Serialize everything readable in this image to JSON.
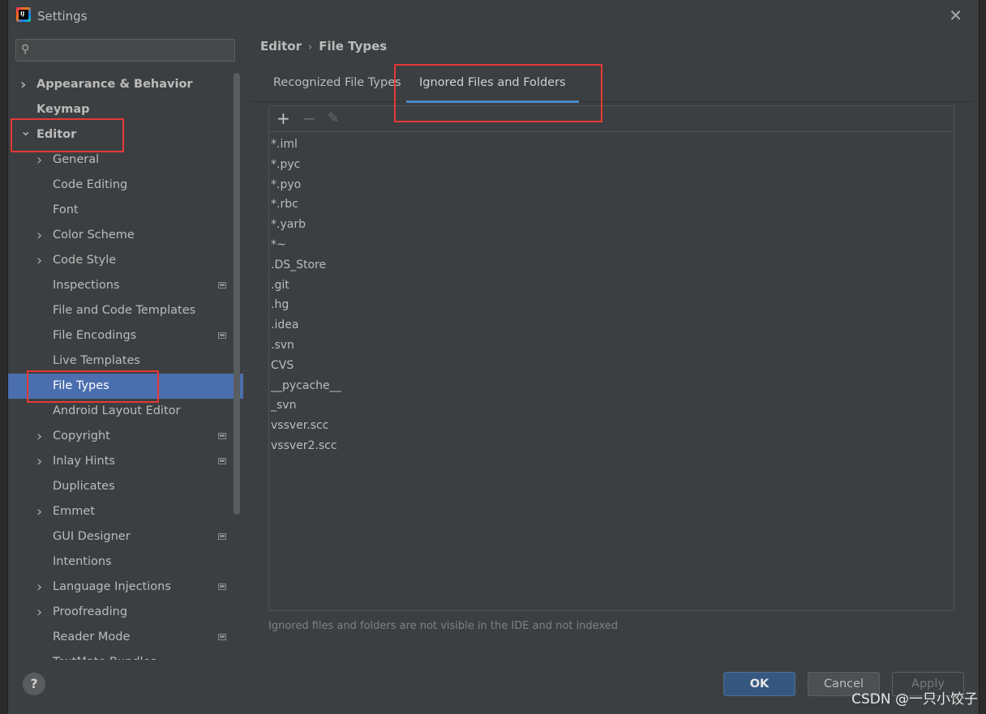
{
  "window": {
    "title": "Settings",
    "close_symbol": "✕"
  },
  "search": {
    "placeholder": "",
    "icon": "search-icon"
  },
  "sidebar": {
    "items": [
      {
        "label": "Appearance & Behavior",
        "level": 0,
        "expandable": true,
        "expanded": false,
        "bold": true,
        "options_icon": false
      },
      {
        "label": "Keymap",
        "level": 0,
        "expandable": false,
        "bold": true,
        "options_icon": false
      },
      {
        "label": "Editor",
        "level": 0,
        "expandable": true,
        "expanded": true,
        "bold": true,
        "options_icon": false
      },
      {
        "label": "General",
        "level": 1,
        "expandable": true,
        "expanded": false,
        "options_icon": false
      },
      {
        "label": "Code Editing",
        "level": 1,
        "expandable": false,
        "options_icon": false
      },
      {
        "label": "Font",
        "level": 1,
        "expandable": false,
        "options_icon": false
      },
      {
        "label": "Color Scheme",
        "level": 1,
        "expandable": true,
        "expanded": false,
        "options_icon": false
      },
      {
        "label": "Code Style",
        "level": 1,
        "expandable": true,
        "expanded": false,
        "options_icon": false
      },
      {
        "label": "Inspections",
        "level": 1,
        "expandable": false,
        "options_icon": true
      },
      {
        "label": "File and Code Templates",
        "level": 1,
        "expandable": false,
        "options_icon": false
      },
      {
        "label": "File Encodings",
        "level": 1,
        "expandable": false,
        "options_icon": true
      },
      {
        "label": "Live Templates",
        "level": 1,
        "expandable": false,
        "options_icon": false
      },
      {
        "label": "File Types",
        "level": 1,
        "expandable": false,
        "selected": true,
        "options_icon": false
      },
      {
        "label": "Android Layout Editor",
        "level": 1,
        "expandable": false,
        "options_icon": false
      },
      {
        "label": "Copyright",
        "level": 1,
        "expandable": true,
        "expanded": false,
        "options_icon": true
      },
      {
        "label": "Inlay Hints",
        "level": 1,
        "expandable": true,
        "expanded": false,
        "options_icon": true
      },
      {
        "label": "Duplicates",
        "level": 1,
        "expandable": false,
        "options_icon": false
      },
      {
        "label": "Emmet",
        "level": 1,
        "expandable": true,
        "expanded": false,
        "options_icon": false
      },
      {
        "label": "GUI Designer",
        "level": 1,
        "expandable": false,
        "options_icon": true
      },
      {
        "label": "Intentions",
        "level": 1,
        "expandable": false,
        "options_icon": false
      },
      {
        "label": "Language Injections",
        "level": 1,
        "expandable": true,
        "expanded": false,
        "options_icon": true
      },
      {
        "label": "Proofreading",
        "level": 1,
        "expandable": true,
        "expanded": false,
        "options_icon": false
      },
      {
        "label": "Reader Mode",
        "level": 1,
        "expandable": false,
        "options_icon": true
      },
      {
        "label": "TextMate Bundles",
        "level": 1,
        "expandable": false,
        "options_icon": false
      }
    ]
  },
  "breadcrumb": {
    "parent": "Editor",
    "separator": "›",
    "current": "File Types"
  },
  "tabs": [
    {
      "label": "Recognized File Types",
      "active": false
    },
    {
      "label": "Ignored Files and Folders",
      "active": true
    }
  ],
  "toolbar": {
    "add": "+",
    "remove": "−",
    "edit": "✎"
  },
  "ignored_list": [
    "*.iml",
    "*.pyc",
    "*.pyo",
    "*.rbc",
    "*.yarb",
    "*~",
    ".DS_Store",
    ".git",
    ".hg",
    ".idea",
    ".svn",
    "CVS",
    "__pycache__",
    "_svn",
    "vssver.scc",
    "vssver2.scc"
  ],
  "hint": "Ignored files and folders are not visible in the IDE and not indexed",
  "footer": {
    "help": "?",
    "ok": "OK",
    "cancel": "Cancel",
    "apply": "Apply"
  },
  "watermark": "CSDN @一只小饺子",
  "colors": {
    "selection": "#4b6eaf",
    "highlight_box": "#e53935",
    "ok_button": "#365880",
    "tab_underline": "#4a88c7"
  }
}
